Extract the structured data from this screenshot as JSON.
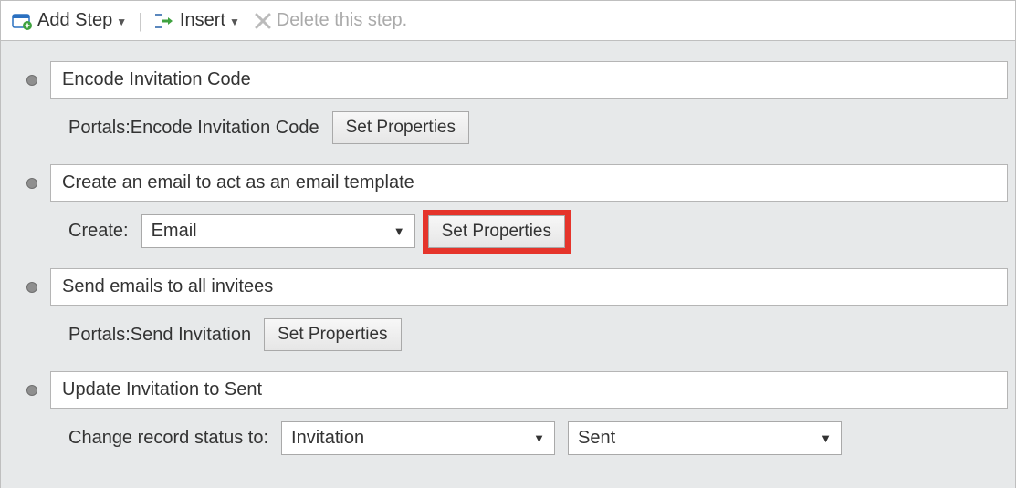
{
  "toolbar": {
    "addStep": "Add Step",
    "insert": "Insert",
    "delete": "Delete this step."
  },
  "steps": {
    "s1": {
      "title": "Encode Invitation Code",
      "detailLabel": "Portals:Encode Invitation Code",
      "button": "Set Properties"
    },
    "s2": {
      "title": "Create an email to act as an email template",
      "detailLabel": "Create:",
      "selectValue": "Email",
      "button": "Set Properties"
    },
    "s3": {
      "title": "Send emails to all invitees",
      "detailLabel": "Portals:Send Invitation",
      "button": "Set Properties"
    },
    "s4": {
      "title": "Update Invitation to Sent",
      "detailLabel": "Change record status to:",
      "select1": "Invitation",
      "select2": "Sent"
    }
  }
}
